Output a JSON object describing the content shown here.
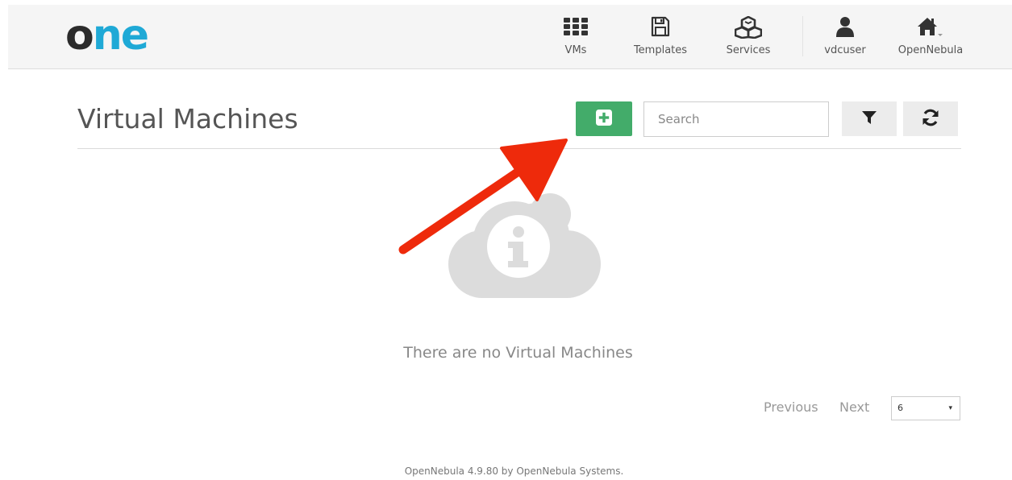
{
  "header": {
    "logo": {
      "part1": "o",
      "part2": "ne"
    },
    "nav": {
      "vms": "VMs",
      "templates": "Templates",
      "services": "Services",
      "user": "vdcuser",
      "zone": "OpenNebula"
    }
  },
  "main": {
    "title": "Virtual Machines",
    "search": {
      "placeholder": "Search",
      "value": ""
    },
    "empty_message": "There are no Virtual Machines",
    "pagination": {
      "previous": "Previous",
      "next": "Next",
      "page_size": "6"
    }
  },
  "footer": {
    "text": "OpenNebula 4.9.80 by OpenNebula Systems."
  },
  "icons": {
    "add": "plus-square-icon",
    "filter": "filter-icon",
    "refresh": "refresh-icon",
    "vms": "grid-icon",
    "templates": "floppy-disk-icon",
    "services": "cubes-icon",
    "user": "user-icon",
    "zone": "home-icon",
    "empty": "cloud-info-icon"
  },
  "colors": {
    "logo_dark": "#2b2b2b",
    "logo_accent": "#1fa9d6",
    "add_button": "#43ac6a",
    "annotation_arrow": "#ee2a0b"
  }
}
